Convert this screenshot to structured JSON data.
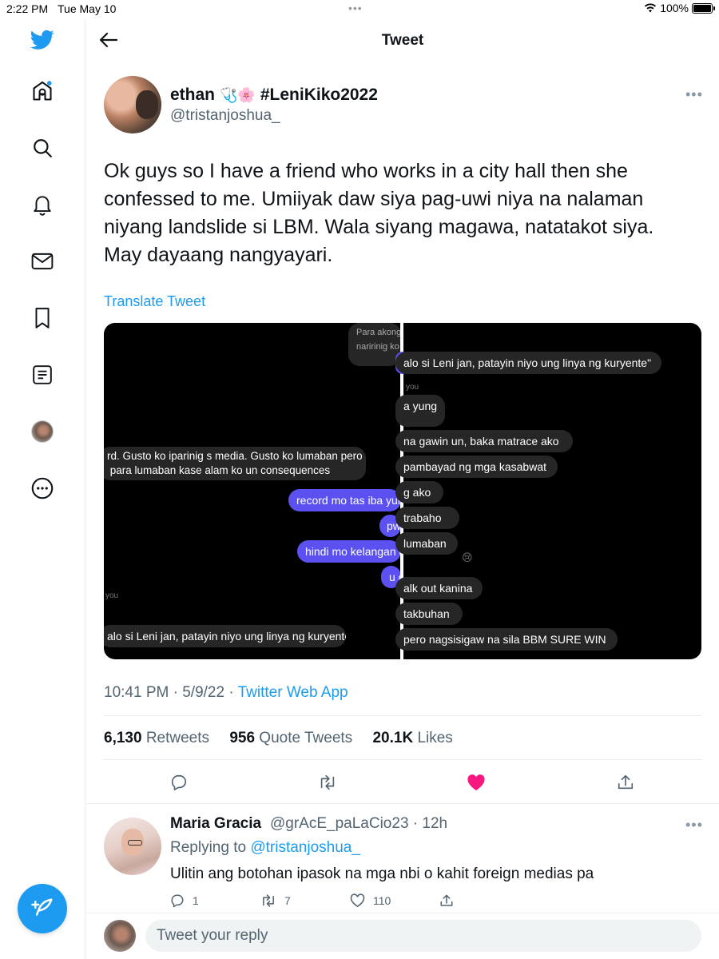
{
  "status_bar": {
    "time": "2:22 PM",
    "date": "Tue May 10",
    "dots": "•••",
    "battery": "100%"
  },
  "header": {
    "title": "Tweet"
  },
  "tweet": {
    "author_name": "ethan",
    "author_emoji": "🩺🌸",
    "author_tag": "#LeniKiko2022",
    "author_handle": "@tristanjoshua_",
    "text": "Ok guys so I have a friend who works in a city hall then she confessed to me. Umiiyak daw siya pag-uwi niya na nalaman niyang landslide si LBM. Wala siyang magawa, natatakot siya. May dayaang nangyayari.",
    "translate_label": "Translate Tweet",
    "time": "10:41 PM",
    "date": "5/9/22",
    "separator": "·",
    "source": "Twitter Web App",
    "retweets_count": "6,130",
    "retweets_label": "Retweets",
    "quotes_count": "956",
    "quotes_label": "Quote Tweets",
    "likes_count": "20.1K",
    "likes_label": "Likes"
  },
  "media_left": {
    "top_gray": "Para akong\nnaririnig ko",
    "gray_block": "rd. Gusto ko iparinig s media. Gusto ko lumaban pero\n para lumaban kase alam ko un consequences",
    "blue_1": "record mo tas iba yung",
    "blue_2": "pw",
    "blue_3": "hindi mo kelangan g",
    "blue_4": "u c",
    "you_label": "you",
    "bottom_gray": "alo si Leni jan, patayin niyo ung linya ng kuryente\""
  },
  "media_right": {
    "blue_top": "alo si Leni jan, patayin niyo ung linya ng kuryente\"",
    "you_label": "you",
    "gray_1": "a yung",
    "gray_2": "na gawin un, baka matrace ako",
    "gray_3": "pambayad ng mga kasabwat",
    "gray_4": "g ako",
    "gray_5": "trabaho",
    "gray_6": "lumaban",
    "emoji": "😢",
    "gray_7": "alk out kanina",
    "gray_8": "takbuhan",
    "gray_9": "pero nagsisigaw na sila BBM SURE WIN"
  },
  "reply": {
    "name": "Maria Gracia",
    "handle": "@grAcE_paLaCio23 · 12h",
    "replying_label": "Replying to",
    "replying_to": "@tristanjoshua_",
    "text": "Ulitin ang botohan ipasok na mga nbi o kahit foreign medias pa",
    "reply_count": "1",
    "retweet_count": "7",
    "like_count": "110"
  },
  "reply_bar": {
    "placeholder": "Tweet your reply"
  },
  "colors": {
    "accent": "#1d9bf0",
    "like": "#f91880",
    "chat_blue": "#5b51f0"
  }
}
